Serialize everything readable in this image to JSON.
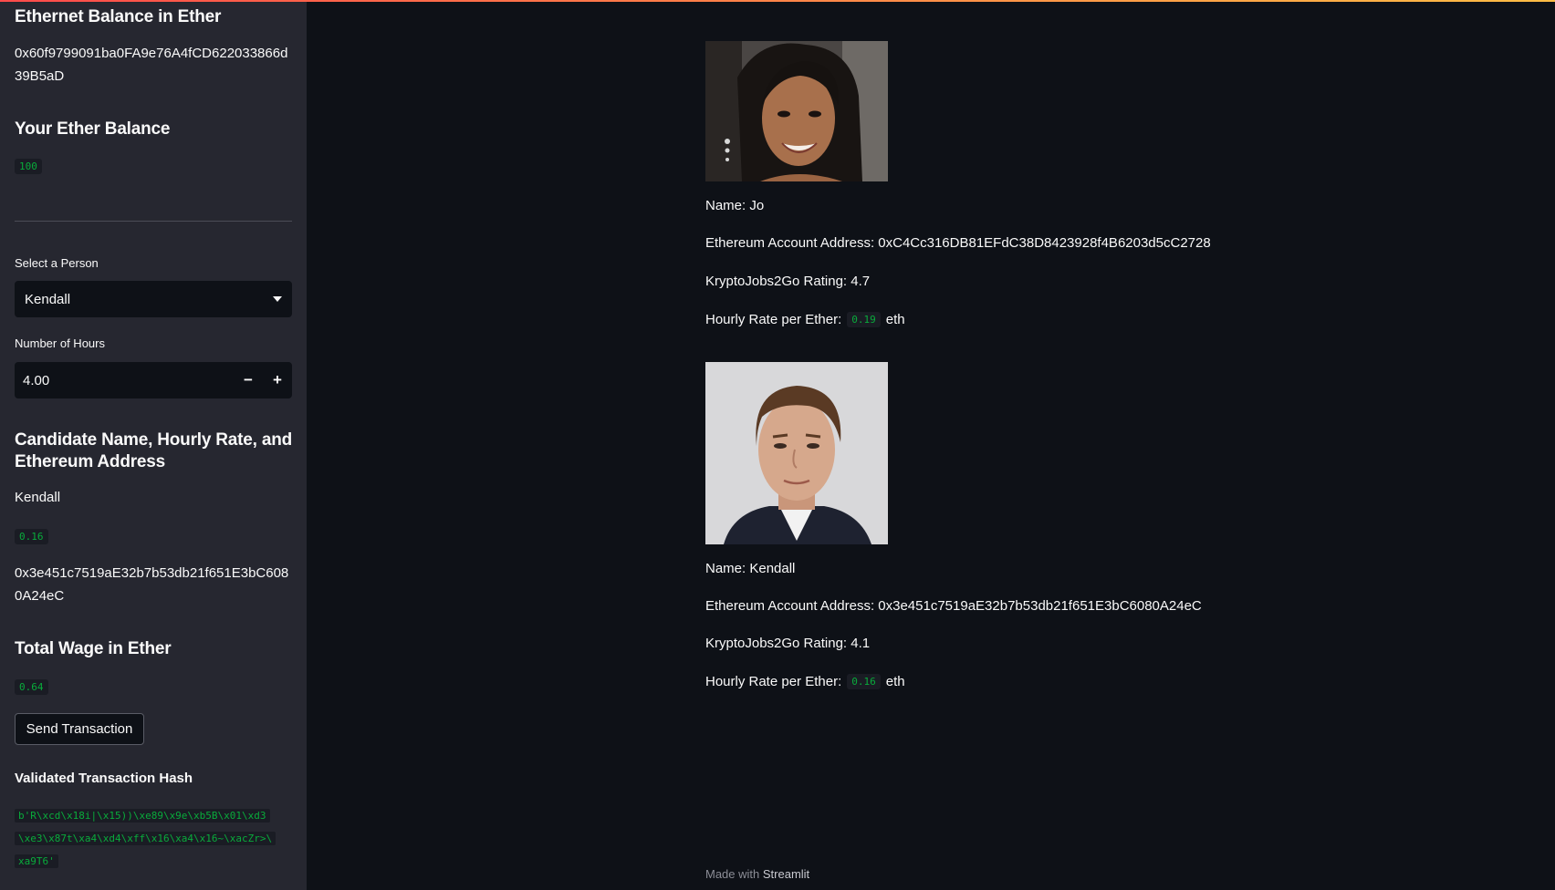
{
  "sidebar": {
    "balance_heading": "Ethernet Balance in Ether",
    "account_address": "0x60f9799091ba0FA9e76A4fCD622033866d39B5aD",
    "your_balance_heading": "Your Ether Balance",
    "your_balance_value": "100",
    "select_person_label": "Select a Person",
    "select_person_value": "Kendall",
    "hours_label": "Number of Hours",
    "hours_value": "4.00",
    "decrement_label": "−",
    "increment_label": "+",
    "candidate_heading": "Candidate Name, Hourly Rate, and Ethereum Address",
    "candidate_name": "Kendall",
    "candidate_rate": "0.16",
    "candidate_address": "0x3e451c7519aE32b7b53db21f651E3bC6080A24eC",
    "total_wage_heading": "Total Wage in Ether",
    "total_wage_value": "0.64",
    "send_button_label": "Send Transaction",
    "hash_heading": "Validated Transaction Hash",
    "hash_lines": [
      "b'R\\xcd\\x18i|\\x15))\\xe89\\x9e\\xb5B\\x01\\xd3",
      "\\xe3\\x87t\\xa4\\xd4\\xff\\x16\\xa4\\x16~\\xacZr>\\",
      "xa9T6'"
    ]
  },
  "candidates": [
    {
      "name_line": "Name: Jo",
      "address_line": "Ethereum Account Address: 0xC4Cc316DB81EFdC38D8423928f4B6203d5cC2728",
      "rating_line": "KryptoJobs2Go Rating: 4.7",
      "rate_prefix": "Hourly Rate per Ether:",
      "rate_value": "0.19",
      "rate_suffix": "eth"
    },
    {
      "name_line": "Name: Kendall",
      "address_line": "Ethereum Account Address: 0x3e451c7519aE32b7b53db21f651E3bC6080A24eC",
      "rating_line": "KryptoJobs2Go Rating: 4.1",
      "rate_prefix": "Hourly Rate per Ether:",
      "rate_value": "0.16",
      "rate_suffix": "eth"
    }
  ],
  "footer": {
    "prefix": "Made with",
    "brand": "Streamlit"
  },
  "colors": {
    "background": "#0e1117",
    "sidebar": "#262730",
    "code_text": "#09ab3b",
    "accent_gradient": [
      "#ff4b4b",
      "#ffbd45"
    ]
  }
}
